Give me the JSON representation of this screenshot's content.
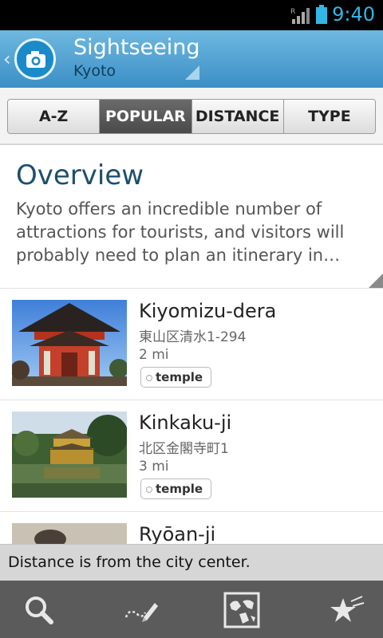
{
  "status_bar": {
    "time": "9:40",
    "signal_label": "R"
  },
  "header": {
    "title": "Sightseeing",
    "subtitle": "Kyoto"
  },
  "tabs": [
    {
      "label": "A-Z",
      "active": false
    },
    {
      "label": "POPULAR",
      "active": true
    },
    {
      "label": "DISTANCE",
      "active": false
    },
    {
      "label": "TYPE",
      "active": false
    }
  ],
  "overview": {
    "heading": "Overview",
    "text": "Kyoto offers an incredible number of attractions for tourists, and visitors will probably need to plan an itinerary in…"
  },
  "places": [
    {
      "name": "Kiyomizu-dera",
      "address": "東山区清水1-294",
      "distance": "2 mi",
      "tag": "temple"
    },
    {
      "name": "Kinkaku-ji",
      "address": "北区金閣寺町1",
      "distance": "3 mi",
      "tag": "temple"
    },
    {
      "name": "Ryōan-ji",
      "address": "",
      "distance": "",
      "tag": ""
    }
  ],
  "toast": {
    "message": "Distance is from the city center."
  },
  "bottom_bar": [
    "search-icon",
    "draw-route-icon",
    "map-icon",
    "favorites-icon"
  ],
  "colors": {
    "accent": "#33b5e5",
    "header": "#3b8fc6",
    "title_text": "#1c4f6e"
  }
}
